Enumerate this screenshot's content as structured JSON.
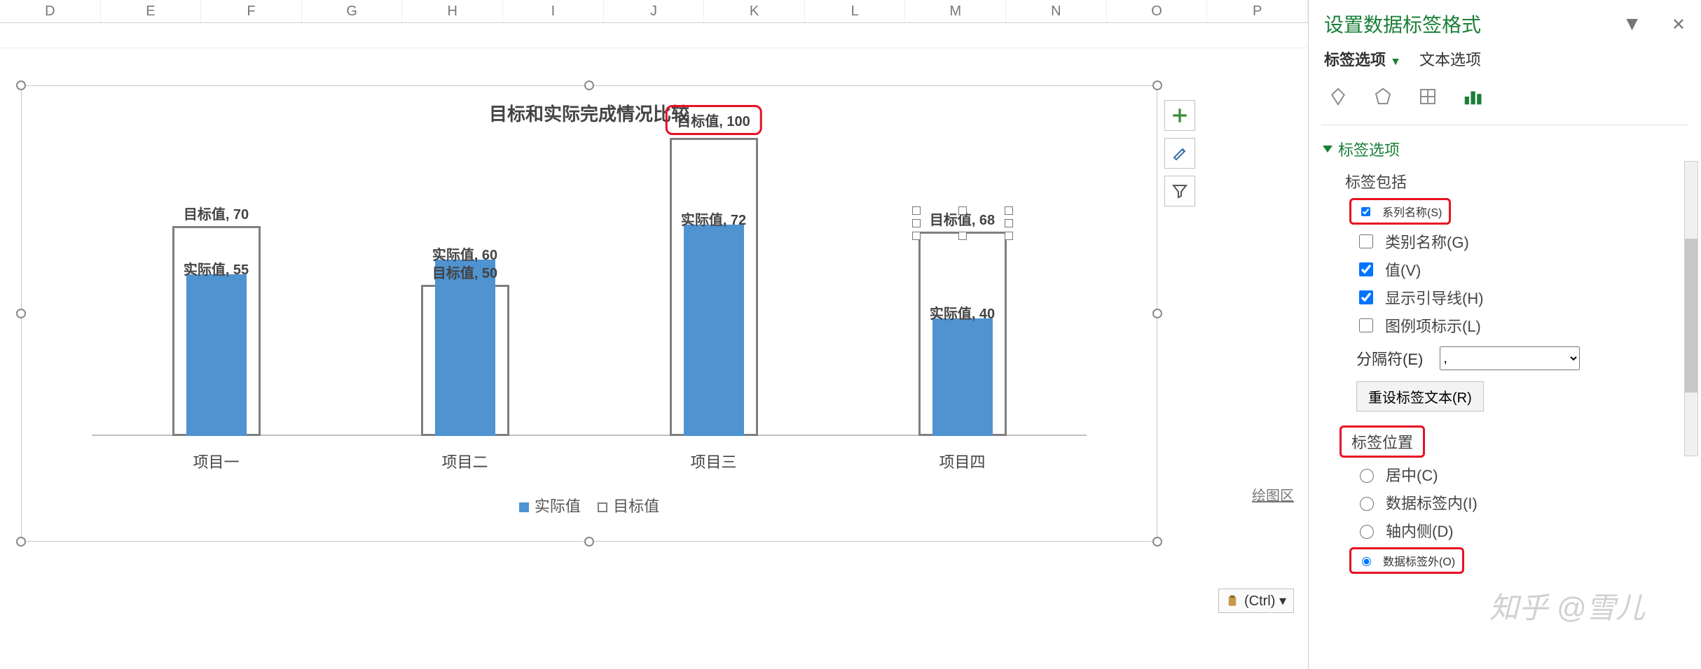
{
  "columns": [
    "D",
    "E",
    "F",
    "G",
    "H",
    "I",
    "J",
    "K",
    "L",
    "M",
    "N",
    "O",
    "P"
  ],
  "chart": {
    "title": "目标和实际完成情况比较",
    "legend_inner": "实际值",
    "legend_outer": "目标值",
    "categories": [
      "项目一",
      "项目二",
      "项目三",
      "项目四"
    ],
    "series": {
      "target": {
        "name": "目标值",
        "values": [
          70,
          50,
          100,
          68
        ]
      },
      "actual": {
        "name": "实际值",
        "values": [
          55,
          60,
          72,
          40
        ]
      }
    },
    "labels": {
      "target": [
        "目标值, 70",
        "目标值, 50",
        "目标值, 100",
        "目标值, 68"
      ],
      "actual": [
        "实际值, 55",
        "实际值, 60",
        "实际值, 72",
        "实际值, 40"
      ]
    },
    "plotarea_hint": "绘图区"
  },
  "chart_data": {
    "type": "bar",
    "title": "目标和实际完成情况比较",
    "categories": [
      "项目一",
      "项目二",
      "项目三",
      "项目四"
    ],
    "series": [
      {
        "name": "目标值",
        "values": [
          70,
          50,
          100,
          68
        ]
      },
      {
        "name": "实际值",
        "values": [
          55,
          60,
          72,
          40
        ]
      }
    ],
    "ylim": [
      0,
      100
    ],
    "ylabel": "",
    "xlabel": ""
  },
  "ctrl_btn": "(Ctrl) ▾",
  "pane": {
    "title": "设置数据标签格式",
    "tabs": {
      "label_opts": "标签选项",
      "text_opts": "文本选项"
    },
    "section_label_opts": "标签选项",
    "label_includes": "标签包括",
    "cb_series_name": "系列名称(S)",
    "cb_category_name": "类别名称(G)",
    "cb_value": "值(V)",
    "cb_show_leader": "显示引导线(H)",
    "cb_legend_key": "图例项标示(L)",
    "separator_label": "分隔符(E)",
    "separator_value": ",",
    "reset_btn": "重设标签文本(R)",
    "label_position": "标签位置",
    "rb_center": "居中(C)",
    "rb_inside_end": "数据标签内(I)",
    "rb_inside_base": "轴内侧(D)",
    "rb_outside_end": "数据标签外(O)"
  },
  "watermark": "知乎 @雪儿"
}
